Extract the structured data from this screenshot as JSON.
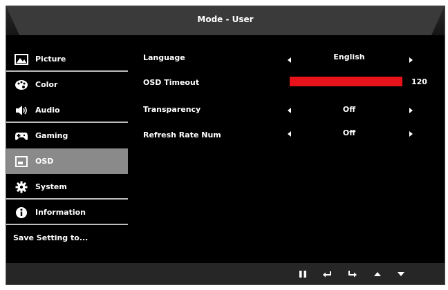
{
  "title": "Mode - User",
  "sidebar": {
    "items": [
      {
        "label": "Picture",
        "icon": "picture-icon"
      },
      {
        "label": "Color",
        "icon": "palette-icon"
      },
      {
        "label": "Audio",
        "icon": "speaker-icon"
      },
      {
        "label": "Gaming",
        "icon": "gamepad-icon"
      },
      {
        "label": "OSD",
        "icon": "osd-icon"
      },
      {
        "label": "System",
        "icon": "gear-icon"
      },
      {
        "label": "Information",
        "icon": "info-icon"
      },
      {
        "label": "Save Setting to..."
      }
    ],
    "active": "OSD"
  },
  "settings": {
    "language": {
      "label": "Language",
      "value": "English"
    },
    "osd_timeout": {
      "label": "OSD Timeout",
      "value": "120",
      "level": 1.0
    },
    "transparency": {
      "label": "Transparency",
      "value": "Off"
    },
    "refresh_rate_num": {
      "label": "Refresh Rate Num",
      "value": "Off"
    }
  },
  "bottom_buttons": [
    "pause-icon",
    "return-icon",
    "enter-icon",
    "up-icon",
    "down-icon"
  ],
  "colors": {
    "accent": "#e8121a",
    "background": "#000000",
    "active_item": "#8a8a8a"
  }
}
